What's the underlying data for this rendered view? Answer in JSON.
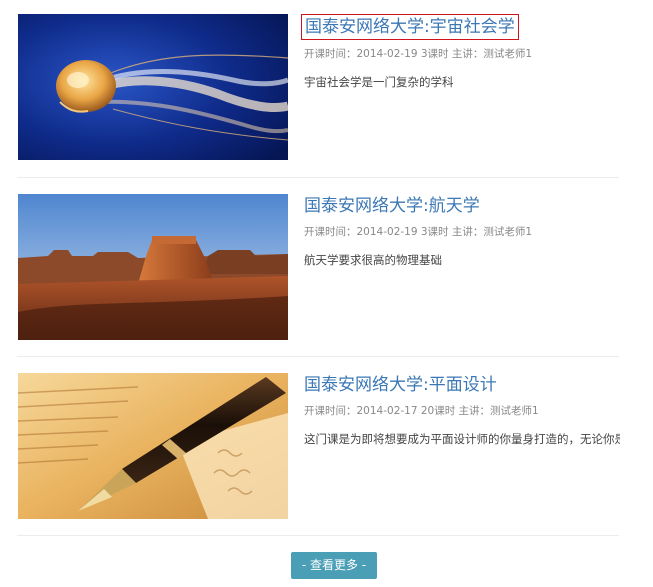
{
  "courses": [
    {
      "title": "国泰安网络大学:宇宙社会学",
      "meta": "开课时间：2014-02-19 3课时 主讲：测试老师1",
      "description": "宇宙社会学是一门复杂的学科",
      "image": "jellyfish"
    },
    {
      "title": "国泰安网络大学:航天学",
      "meta": "开课时间：2014-02-19 3课时 主讲：测试老师1",
      "description": "航天学要求很高的物理基础",
      "image": "desert-mesa"
    },
    {
      "title": "国泰安网络大学:平面设计",
      "meta": "开课时间：2014-02-17 20课时 主讲：测试老师1",
      "description": "这门课是为即将想要成为平面设计师的你量身打造的，无论你是",
      "image": "fountain-pen"
    }
  ],
  "more_button": {
    "label": "- 查看更多 -"
  },
  "colors": {
    "title": "#3c78b5",
    "focus_border": "#d0141b",
    "button": "#4a9eb5"
  }
}
